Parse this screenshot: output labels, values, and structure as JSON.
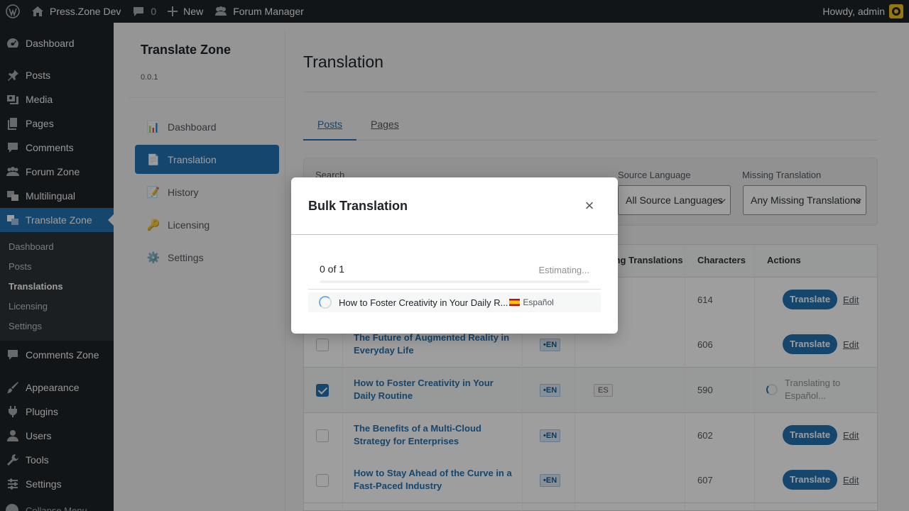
{
  "adminbar": {
    "site_name": "Press.Zone Dev",
    "comments_count": "0",
    "new_label": "New",
    "forum_manager": "Forum Manager",
    "howdy": "Howdy, admin"
  },
  "sidebar": {
    "items": [
      {
        "label": "Dashboard"
      },
      {
        "label": "Posts"
      },
      {
        "label": "Media"
      },
      {
        "label": "Pages"
      },
      {
        "label": "Comments"
      },
      {
        "label": "Forum Zone"
      },
      {
        "label": "Multilingual"
      },
      {
        "label": "Translate Zone"
      },
      {
        "label": "Comments Zone"
      },
      {
        "label": "Appearance"
      },
      {
        "label": "Plugins"
      },
      {
        "label": "Users"
      },
      {
        "label": "Tools"
      },
      {
        "label": "Settings"
      }
    ],
    "submenu": [
      "Dashboard",
      "Posts",
      "Translations",
      "Licensing",
      "Settings"
    ],
    "collapse": "Collapse Menu"
  },
  "plugin_nav": {
    "title": "Translate Zone",
    "version": "0.0.1",
    "items": [
      {
        "label": "Dashboard",
        "icon": "📊"
      },
      {
        "label": "Translation",
        "icon": "📄"
      },
      {
        "label": "History",
        "icon": "📝"
      },
      {
        "label": "Licensing",
        "icon": "🔑"
      },
      {
        "label": "Settings",
        "icon": "⚙️"
      }
    ]
  },
  "main": {
    "title": "Translation",
    "tabs": [
      "Posts",
      "Pages"
    ],
    "filters": {
      "search_label": "Search",
      "source_label": "Source Language",
      "source_value": "All Source Languages",
      "missing_label": "Missing Translation",
      "missing_value": "Any Missing Translations"
    },
    "table": {
      "headers": {
        "missing": "Missing Translations",
        "characters": "Characters",
        "actions": "Actions"
      },
      "translate_label": "Translate",
      "edit_label": "Edit",
      "rows": [
        {
          "title": "",
          "lang": "",
          "missing": "",
          "chars": "614"
        },
        {
          "title": "The Future of Augmented Reality in Everyday Life",
          "lang": "•EN",
          "missing": "",
          "chars": "606"
        },
        {
          "title": "How to Foster Creativity in Your Daily Routine",
          "lang": "•EN",
          "missing": "ES",
          "chars": "590",
          "status": "Translating to Español..."
        },
        {
          "title": "The Benefits of a Multi-Cloud Strategy for Enterprises",
          "lang": "•EN",
          "missing": "",
          "chars": "602"
        },
        {
          "title": "How to Stay Ahead of the Curve in a Fast-Paced Industry",
          "lang": "•EN",
          "missing": "",
          "chars": "607"
        }
      ]
    }
  },
  "modal": {
    "title": "Bulk Translation",
    "close": "×",
    "progress_text": "0 of 1",
    "progress_value": 0,
    "estimate": "Estimating...",
    "item_title": "How to Foster Creativity in Your Daily R...",
    "item_lang": "Español"
  },
  "colors": {
    "accent": "#2271b1",
    "admin_dark": "#1d2327"
  }
}
